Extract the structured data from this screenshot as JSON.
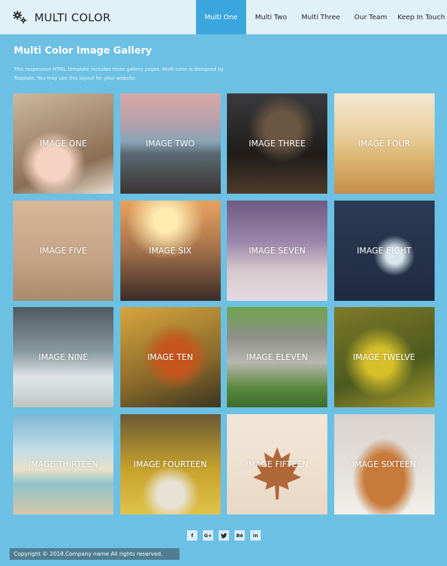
{
  "header": {
    "brand_name": "MULTI COLOR",
    "brand_icon": "gears-icon",
    "nav": [
      {
        "label": "Multi One",
        "active": true
      },
      {
        "label": "Multi Two",
        "active": false
      },
      {
        "label": "Multi Three",
        "active": false
      },
      {
        "label": "Our Team",
        "active": false
      },
      {
        "label": "Keep In Touch",
        "active": false
      }
    ]
  },
  "intro": {
    "title": "Multi Color Image Gallery",
    "description": "This responsive HTML template includes three gallery pages. Multi color is designed by Tooplate. You may use this layout for your website."
  },
  "gallery": {
    "items": [
      "IMAGE ONE",
      "IMAGE TWO",
      "IMAGE THREE",
      "IMAGE FOUR",
      "IMAGE FIVE",
      "IMAGE SIX",
      "IMAGE SEVEN",
      "IMAGE EIGHT",
      "IMAGE NINE",
      "IMAGE TEN",
      "IMAGE ELEVEN",
      "IMAGE TWELVE",
      "IMAGE THIRTEEN",
      "IMAGE FOURTEEN",
      "IMAGE FIFTEEN",
      "IMAGE SIXTEEN"
    ]
  },
  "footer": {
    "social": [
      {
        "label": "f",
        "icon": "facebook-icon"
      },
      {
        "label": "G+",
        "icon": "google-plus-icon"
      },
      {
        "label": "•",
        "icon": "twitter-icon"
      },
      {
        "label": "Bé",
        "icon": "behance-icon"
      },
      {
        "label": "in",
        "icon": "linkedin-icon"
      }
    ],
    "copyright": "Copyright © 2018.Company name All rights reserved."
  },
  "colors": {
    "page_bg": "#6cc0e3",
    "header_bg": "#e1f1f8",
    "nav_active": "#3aa6dd",
    "copyright_bg": "#4f7d92"
  }
}
